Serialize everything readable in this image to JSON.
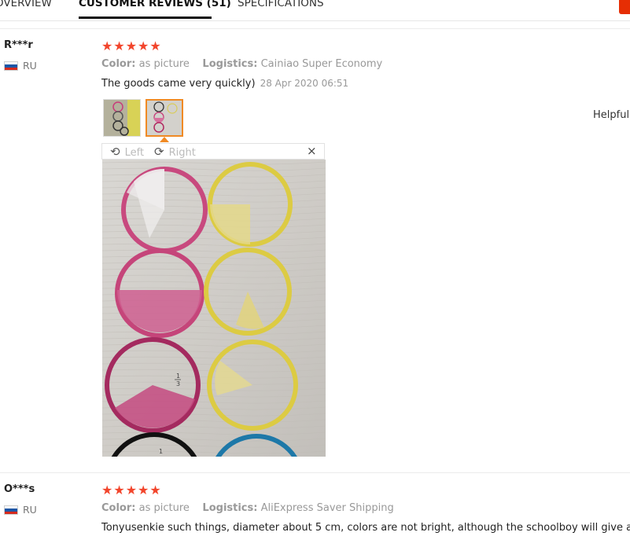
{
  "tabs": [
    {
      "label": "OVERVIEW",
      "active": false
    },
    {
      "label": "CUSTOMER REVIEWS (51)",
      "active": true
    },
    {
      "label": "SPECIFICATIONS",
      "active": false
    }
  ],
  "reviews": [
    {
      "user": "R***r",
      "country": "RU",
      "rating": "★★★★★",
      "color_label": "Color:",
      "color_value": "as picture",
      "logistics_label": "Logistics:",
      "logistics_value": "Cainiao Super Economy",
      "text": "The goods came very quickly)",
      "date": "28 Apr 2020 06:51",
      "helpful": "Helpful?"
    },
    {
      "user": "O***s",
      "country": "RU",
      "rating": "★★★★★",
      "color_label": "Color:",
      "color_value": "as picture",
      "logistics_label": "Logistics:",
      "logistics_value": "AliExpress Saver Shipping",
      "text": "Tonyusenkie such things, diameter about 5 cm, colors are not bright, although the schoolboy will give an"
    }
  ],
  "viewer": {
    "rotate_left_icon": "rotate-left-icon",
    "rotate_left": "Left",
    "rotate_right_icon": "rotate-right-icon",
    "rotate_right": "Right",
    "close_icon": "×"
  },
  "colors": {
    "star": "#f2452c",
    "selected_border": "#f08a24",
    "accent_red": "#e62e04"
  }
}
